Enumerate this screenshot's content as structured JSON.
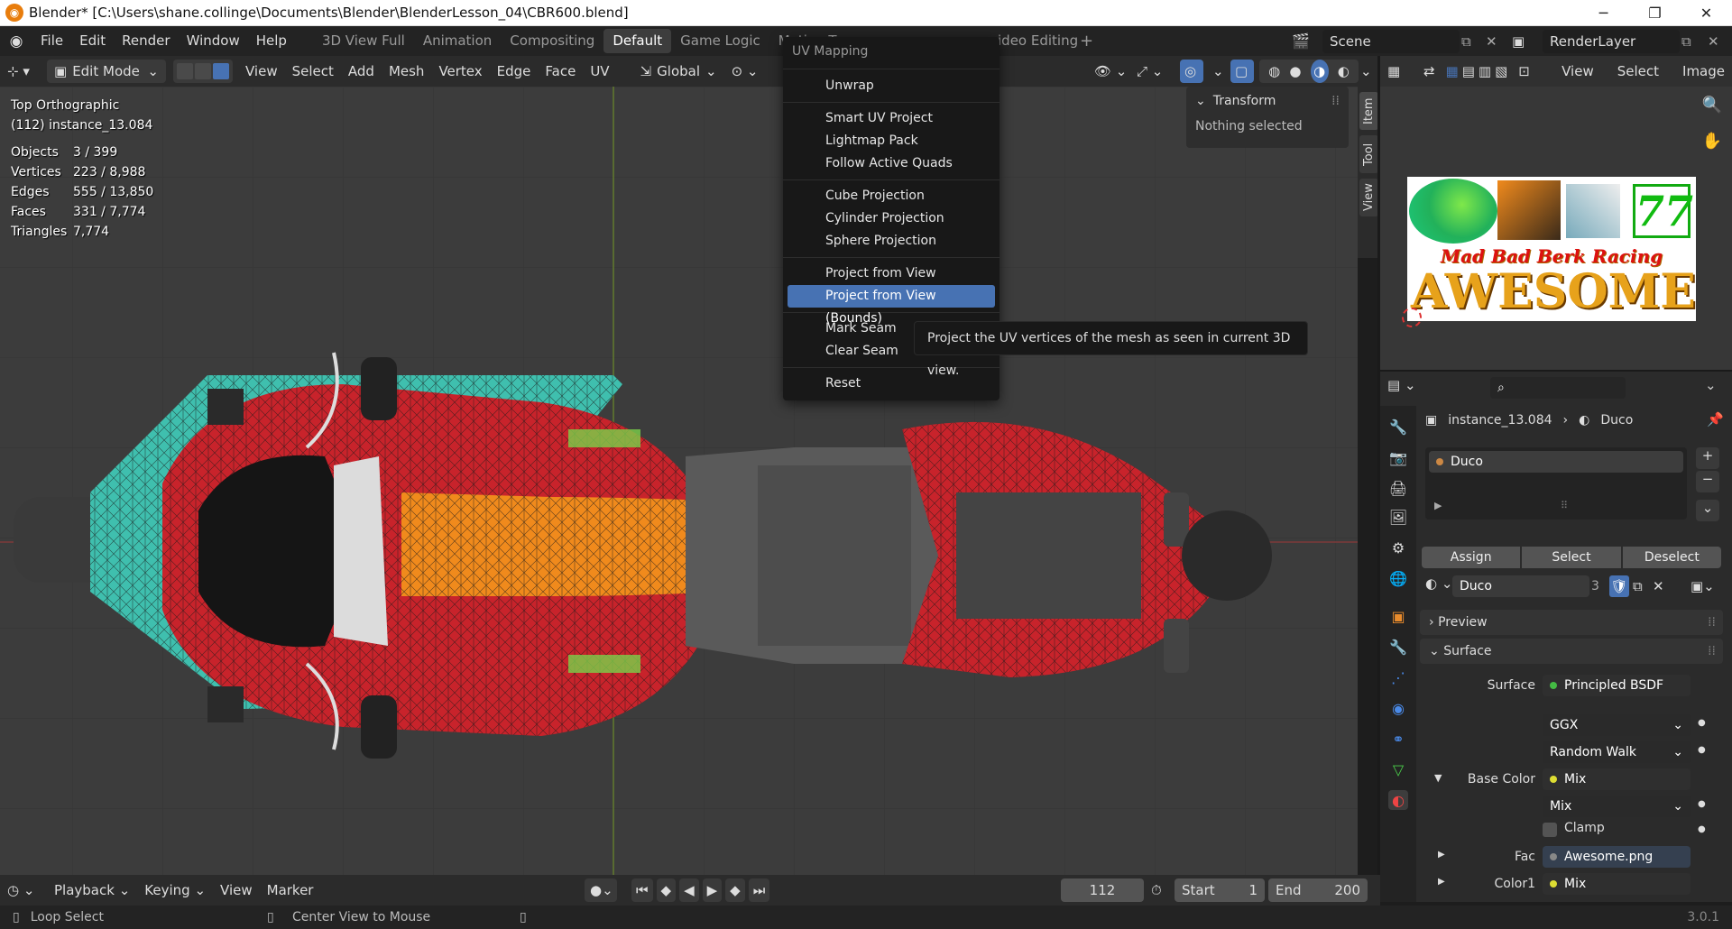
{
  "window": {
    "title": "Blender* [C:\\Users\\shane.collinge\\Documents\\Blender\\BlenderLesson_04\\CBR600.blend]"
  },
  "topbar": {
    "menus": [
      "File",
      "Edit",
      "Render",
      "Window",
      "Help"
    ],
    "workspaces": [
      "3D View Full",
      "Animation",
      "Compositing",
      "Default",
      "Game Logic",
      "Motion Tra",
      "ideo Editing"
    ],
    "active_workspace": "Default",
    "scene": "Scene",
    "render_layer": "RenderLayer"
  },
  "viewport_header": {
    "mode": "Edit Mode",
    "menus": [
      "View",
      "Select",
      "Add",
      "Mesh",
      "Vertex",
      "Edge",
      "Face",
      "UV"
    ],
    "orientation": "Global"
  },
  "viewport": {
    "view_name": "Top Orthographic",
    "object_name": "(112) instance_13.084",
    "stats": [
      {
        "label": "Objects",
        "value": "3 / 399"
      },
      {
        "label": "Vertices",
        "value": "223 / 8,988"
      },
      {
        "label": "Edges",
        "value": "555 / 13,850"
      },
      {
        "label": "Faces",
        "value": "331 / 7,774"
      },
      {
        "label": "Triangles",
        "value": "7,774"
      }
    ]
  },
  "npanel": {
    "section": "Transform",
    "message": "Nothing selected",
    "tabs": [
      "Item",
      "Tool",
      "View"
    ]
  },
  "uv_menu": {
    "title": "UV Mapping",
    "groups": [
      [
        "Unwrap"
      ],
      [
        "Smart UV Project",
        "Lightmap Pack",
        "Follow Active Quads"
      ],
      [
        "Cube Projection",
        "Cylinder Projection",
        "Sphere Projection"
      ],
      [
        "Project from View",
        "Project from View (Bounds)"
      ],
      [
        "Mark Seam",
        "Clear Seam"
      ],
      [
        "Reset"
      ]
    ],
    "highlighted": "Project from View (Bounds)"
  },
  "tooltip": "Project the UV vertices of the mesh as seen in current 3D view.",
  "image_editor": {
    "menus": [
      "View",
      "Select",
      "Image"
    ],
    "texture_text_top": "Mad Bad Berk Racing",
    "texture_text_main": "AWESOME",
    "texture_number": "77"
  },
  "properties": {
    "breadcrumb_object": "instance_13.084",
    "breadcrumb_material": "Duco",
    "material_slot": "Duco",
    "buttons": [
      "Assign",
      "Select",
      "Deselect"
    ],
    "material_name": "Duco",
    "users": "3",
    "panels": [
      "Preview",
      "Surface"
    ],
    "surface_label": "Surface",
    "surface_value": "Principled BSDF",
    "distribution": "GGX",
    "subsurface": "Random Walk",
    "base_color_label": "Base Color",
    "base_color_value": "Mix",
    "mix_mode": "Mix",
    "clamp_label": "Clamp",
    "fac_label": "Fac",
    "fac_value": "Awesome.png",
    "color1_label": "Color1",
    "color1_value": "Mix"
  },
  "timeline": {
    "menus": [
      "Playback",
      "Keying",
      "View",
      "Marker"
    ],
    "current_frame": "112",
    "start_label": "Start",
    "start": "1",
    "end_label": "End",
    "end": "200"
  },
  "statusbar": {
    "left": "Loop Select",
    "middle": "Center View to Mouse",
    "version": "3.0.1"
  },
  "colors": {
    "accent": "#4772b3",
    "bike_red": "#c8232b",
    "teal": "#3fbfae",
    "orange": "#f08a1c"
  }
}
